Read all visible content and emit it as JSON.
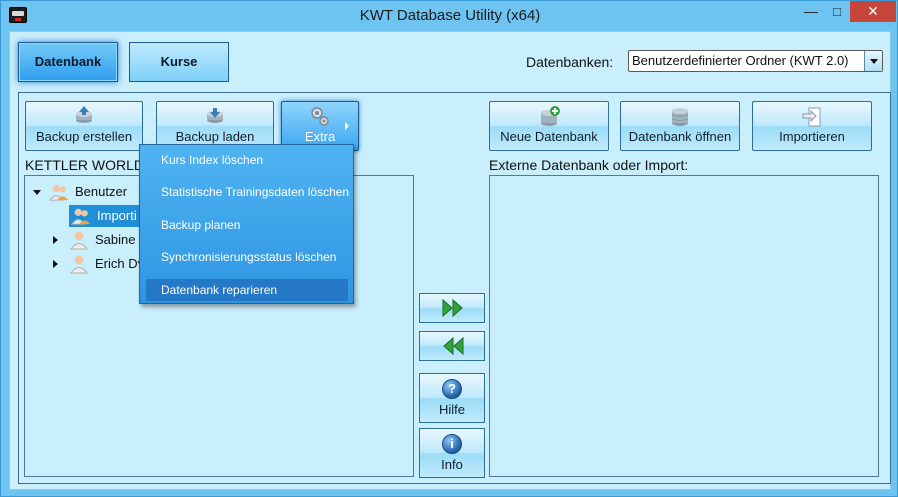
{
  "window": {
    "title": "KWT Database Utility (x64)",
    "minimize": "—",
    "maximize": "□",
    "close": "✕"
  },
  "tabs": [
    {
      "label": "Datenbank",
      "active": true
    },
    {
      "label": "Kurse",
      "active": false
    }
  ],
  "database_selector": {
    "label": "Datenbanken:",
    "selected": "Benutzerdefinierter Ordner (KWT 2.0)"
  },
  "toolbar_left": {
    "backup_create": "Backup erstellen",
    "backup_load": "Backup laden",
    "extra": "Extra"
  },
  "toolbar_right": {
    "new_db": "Neue Datenbank",
    "open_db": "Datenbank öffnen",
    "import": "Importieren"
  },
  "left_panel": {
    "label": "KETTLER WORLD",
    "tree": [
      {
        "label": "Benutzer",
        "expanded": true,
        "level": 0
      },
      {
        "label": "Importi",
        "level": 1,
        "selected": true
      },
      {
        "label": "Sabine",
        "level": 1
      },
      {
        "label": "Erich Dv",
        "level": 1
      }
    ]
  },
  "right_panel": {
    "label": "Externe Datenbank oder Import:"
  },
  "side_buttons": {
    "help": "Hilfe",
    "help_glyph": "?",
    "info": "Info",
    "info_glyph": "i"
  },
  "extra_menu": {
    "items": [
      {
        "label": "Kurs Index löschen"
      },
      {
        "label": "Statistische Trainingsdaten löschen"
      },
      {
        "label": "Backup planen"
      },
      {
        "label": "Synchronisierungsstatus löschen"
      },
      {
        "label": "Datenbank reparieren",
        "highlighted": true
      }
    ]
  },
  "colors": {
    "accent": "#2e95e2",
    "panel_bg": "#c9eefc",
    "window_bg": "#6ec4f0",
    "arrow_green": "#2fa43a",
    "close_red": "#c7463c"
  }
}
